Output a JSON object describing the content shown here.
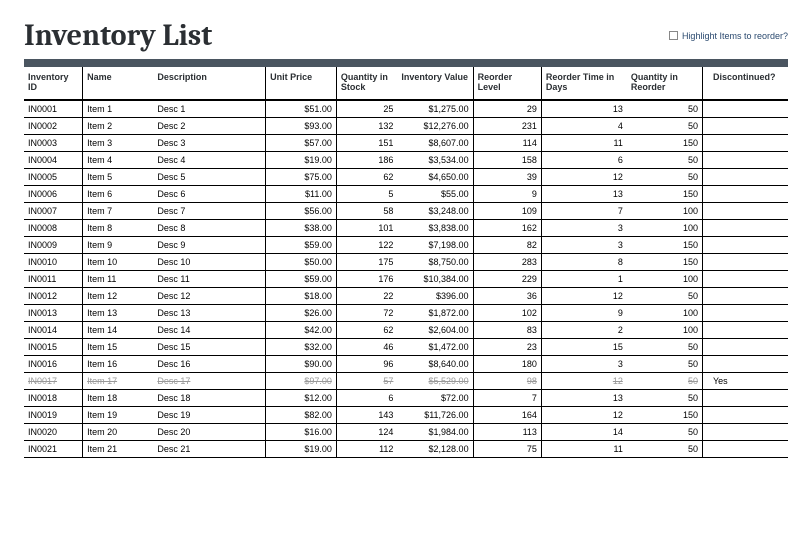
{
  "title": "Inventory List",
  "highlight_label": "Highlight Items to reorder?",
  "columns": {
    "id": "Inventory ID",
    "name": "Name",
    "desc": "Description",
    "price": "Unit Price",
    "qty": "Quantity in Stock",
    "val": "Inventory Value",
    "reord": "Reorder Level",
    "rtime": "Reorder Time in Days",
    "qreord": "Quantity in Reorder",
    "disc": "Discontinued?"
  },
  "rows": [
    {
      "id": "IN0001",
      "name": "Item 1",
      "desc": "Desc 1",
      "price": "$51.00",
      "qty": "25",
      "val": "$1,275.00",
      "reord": "29",
      "rtime": "13",
      "qreord": "50",
      "disc": "",
      "discontinued": false
    },
    {
      "id": "IN0002",
      "name": "Item 2",
      "desc": "Desc 2",
      "price": "$93.00",
      "qty": "132",
      "val": "$12,276.00",
      "reord": "231",
      "rtime": "4",
      "qreord": "50",
      "disc": "",
      "discontinued": false
    },
    {
      "id": "IN0003",
      "name": "Item 3",
      "desc": "Desc 3",
      "price": "$57.00",
      "qty": "151",
      "val": "$8,607.00",
      "reord": "114",
      "rtime": "11",
      "qreord": "150",
      "disc": "",
      "discontinued": false
    },
    {
      "id": "IN0004",
      "name": "Item 4",
      "desc": "Desc 4",
      "price": "$19.00",
      "qty": "186",
      "val": "$3,534.00",
      "reord": "158",
      "rtime": "6",
      "qreord": "50",
      "disc": "",
      "discontinued": false
    },
    {
      "id": "IN0005",
      "name": "Item 5",
      "desc": "Desc 5",
      "price": "$75.00",
      "qty": "62",
      "val": "$4,650.00",
      "reord": "39",
      "rtime": "12",
      "qreord": "50",
      "disc": "",
      "discontinued": false
    },
    {
      "id": "IN0006",
      "name": "Item 6",
      "desc": "Desc 6",
      "price": "$11.00",
      "qty": "5",
      "val": "$55.00",
      "reord": "9",
      "rtime": "13",
      "qreord": "150",
      "disc": "",
      "discontinued": false
    },
    {
      "id": "IN0007",
      "name": "Item 7",
      "desc": "Desc 7",
      "price": "$56.00",
      "qty": "58",
      "val": "$3,248.00",
      "reord": "109",
      "rtime": "7",
      "qreord": "100",
      "disc": "",
      "discontinued": false
    },
    {
      "id": "IN0008",
      "name": "Item 8",
      "desc": "Desc 8",
      "price": "$38.00",
      "qty": "101",
      "val": "$3,838.00",
      "reord": "162",
      "rtime": "3",
      "qreord": "100",
      "disc": "",
      "discontinued": false
    },
    {
      "id": "IN0009",
      "name": "Item 9",
      "desc": "Desc 9",
      "price": "$59.00",
      "qty": "122",
      "val": "$7,198.00",
      "reord": "82",
      "rtime": "3",
      "qreord": "150",
      "disc": "",
      "discontinued": false
    },
    {
      "id": "IN0010",
      "name": "Item 10",
      "desc": "Desc 10",
      "price": "$50.00",
      "qty": "175",
      "val": "$8,750.00",
      "reord": "283",
      "rtime": "8",
      "qreord": "150",
      "disc": "",
      "discontinued": false
    },
    {
      "id": "IN0011",
      "name": "Item 11",
      "desc": "Desc 11",
      "price": "$59.00",
      "qty": "176",
      "val": "$10,384.00",
      "reord": "229",
      "rtime": "1",
      "qreord": "100",
      "disc": "",
      "discontinued": false
    },
    {
      "id": "IN0012",
      "name": "Item 12",
      "desc": "Desc 12",
      "price": "$18.00",
      "qty": "22",
      "val": "$396.00",
      "reord": "36",
      "rtime": "12",
      "qreord": "50",
      "disc": "",
      "discontinued": false
    },
    {
      "id": "IN0013",
      "name": "Item 13",
      "desc": "Desc 13",
      "price": "$26.00",
      "qty": "72",
      "val": "$1,872.00",
      "reord": "102",
      "rtime": "9",
      "qreord": "100",
      "disc": "",
      "discontinued": false
    },
    {
      "id": "IN0014",
      "name": "Item 14",
      "desc": "Desc 14",
      "price": "$42.00",
      "qty": "62",
      "val": "$2,604.00",
      "reord": "83",
      "rtime": "2",
      "qreord": "100",
      "disc": "",
      "discontinued": false
    },
    {
      "id": "IN0015",
      "name": "Item 15",
      "desc": "Desc 15",
      "price": "$32.00",
      "qty": "46",
      "val": "$1,472.00",
      "reord": "23",
      "rtime": "15",
      "qreord": "50",
      "disc": "",
      "discontinued": false
    },
    {
      "id": "IN0016",
      "name": "Item 16",
      "desc": "Desc 16",
      "price": "$90.00",
      "qty": "96",
      "val": "$8,640.00",
      "reord": "180",
      "rtime": "3",
      "qreord": "50",
      "disc": "",
      "discontinued": false
    },
    {
      "id": "IN0017",
      "name": "Item 17",
      "desc": "Desc 17",
      "price": "$97.00",
      "qty": "57",
      "val": "$5,529.00",
      "reord": "98",
      "rtime": "12",
      "qreord": "50",
      "disc": "Yes",
      "discontinued": true
    },
    {
      "id": "IN0018",
      "name": "Item 18",
      "desc": "Desc 18",
      "price": "$12.00",
      "qty": "6",
      "val": "$72.00",
      "reord": "7",
      "rtime": "13",
      "qreord": "50",
      "disc": "",
      "discontinued": false
    },
    {
      "id": "IN0019",
      "name": "Item 19",
      "desc": "Desc 19",
      "price": "$82.00",
      "qty": "143",
      "val": "$11,726.00",
      "reord": "164",
      "rtime": "12",
      "qreord": "150",
      "disc": "",
      "discontinued": false
    },
    {
      "id": "IN0020",
      "name": "Item 20",
      "desc": "Desc 20",
      "price": "$16.00",
      "qty": "124",
      "val": "$1,984.00",
      "reord": "113",
      "rtime": "14",
      "qreord": "50",
      "disc": "",
      "discontinued": false
    },
    {
      "id": "IN0021",
      "name": "Item 21",
      "desc": "Desc 21",
      "price": "$19.00",
      "qty": "112",
      "val": "$2,128.00",
      "reord": "75",
      "rtime": "11",
      "qreord": "50",
      "disc": "",
      "discontinued": false
    }
  ]
}
